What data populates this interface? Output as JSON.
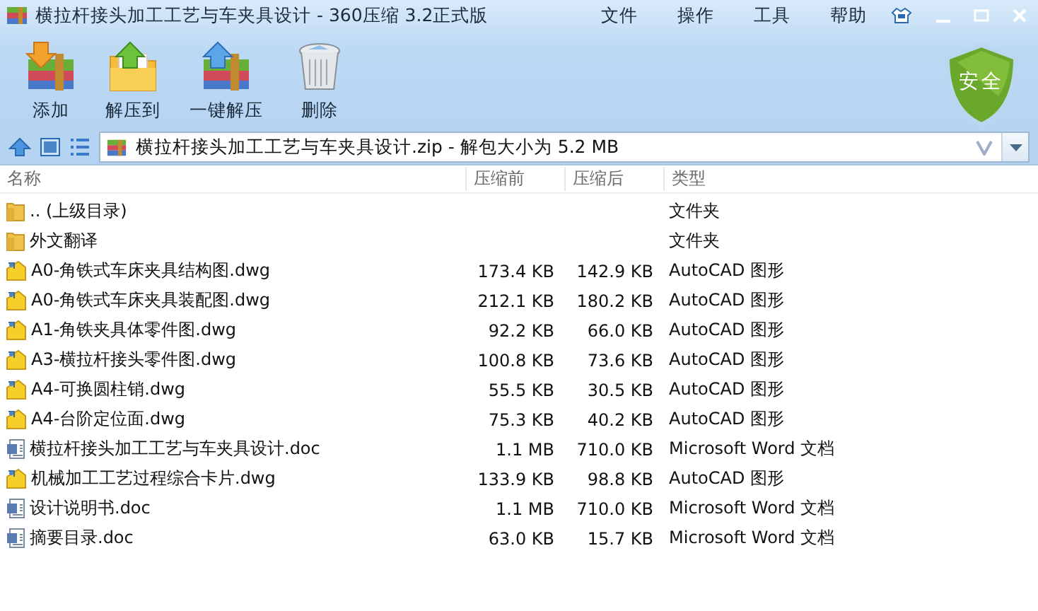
{
  "window": {
    "title": "横拉杆接头加工工艺与车夹具设计 - 360压缩 3.2正式版"
  },
  "menu": [
    "文件",
    "操作",
    "工具",
    "帮助"
  ],
  "toolbar": [
    {
      "label": "添加",
      "kind": "add"
    },
    {
      "label": "解压到",
      "kind": "extract"
    },
    {
      "label": "一键解压",
      "kind": "quick"
    },
    {
      "label": "删除",
      "kind": "delete"
    }
  ],
  "security_badge": {
    "label": "安全"
  },
  "address_bar": {
    "value": "横拉杆接头加工工艺与车夹具设计.zip - 解包大小为 5.2 MB"
  },
  "table": {
    "columns": [
      "名称",
      "压缩前",
      "压缩后",
      "类型"
    ],
    "rows": [
      {
        "kind": "folder",
        "name": ".. (上级目录)",
        "type": "文件夹"
      },
      {
        "kind": "folder",
        "name": "外文翻译",
        "type": "文件夹"
      },
      {
        "kind": "dwg",
        "name": "A0-角铁式车床夹具结构图.dwg",
        "before": "173.4 KB",
        "after": "142.9 KB",
        "type": "AutoCAD 图形"
      },
      {
        "kind": "dwg",
        "name": "A0-角铁式车床夹具装配图.dwg",
        "before": "212.1 KB",
        "after": "180.2 KB",
        "type": "AutoCAD 图形"
      },
      {
        "kind": "dwg",
        "name": "A1-角铁夹具体零件图.dwg",
        "before": "92.2 KB",
        "after": "66.0 KB",
        "type": "AutoCAD 图形"
      },
      {
        "kind": "dwg",
        "name": "A3-横拉杆接头零件图.dwg",
        "before": "100.8 KB",
        "after": "73.6 KB",
        "type": "AutoCAD 图形"
      },
      {
        "kind": "dwg",
        "name": "A4-可换圆柱销.dwg",
        "before": "55.5 KB",
        "after": "30.5 KB",
        "type": "AutoCAD 图形"
      },
      {
        "kind": "dwg",
        "name": "A4-台阶定位面.dwg",
        "before": "75.3 KB",
        "after": "40.2 KB",
        "type": "AutoCAD 图形"
      },
      {
        "kind": "doc",
        "name": "横拉杆接头加工工艺与车夹具设计.doc",
        "before": "1.1 MB",
        "after": "710.0 KB",
        "type": "Microsoft Word 文档"
      },
      {
        "kind": "dwg",
        "name": "机械加工工艺过程综合卡片.dwg",
        "before": "133.9 KB",
        "after": "98.8 KB",
        "type": "AutoCAD 图形"
      },
      {
        "kind": "doc",
        "name": "设计说明书.doc",
        "before": "1.1 MB",
        "after": "710.0 KB",
        "type": "Microsoft Word 文档"
      },
      {
        "kind": "doc",
        "name": "摘要目录.doc",
        "before": "63.0 KB",
        "after": "15.7 KB",
        "type": "Microsoft Word 文档"
      }
    ]
  }
}
